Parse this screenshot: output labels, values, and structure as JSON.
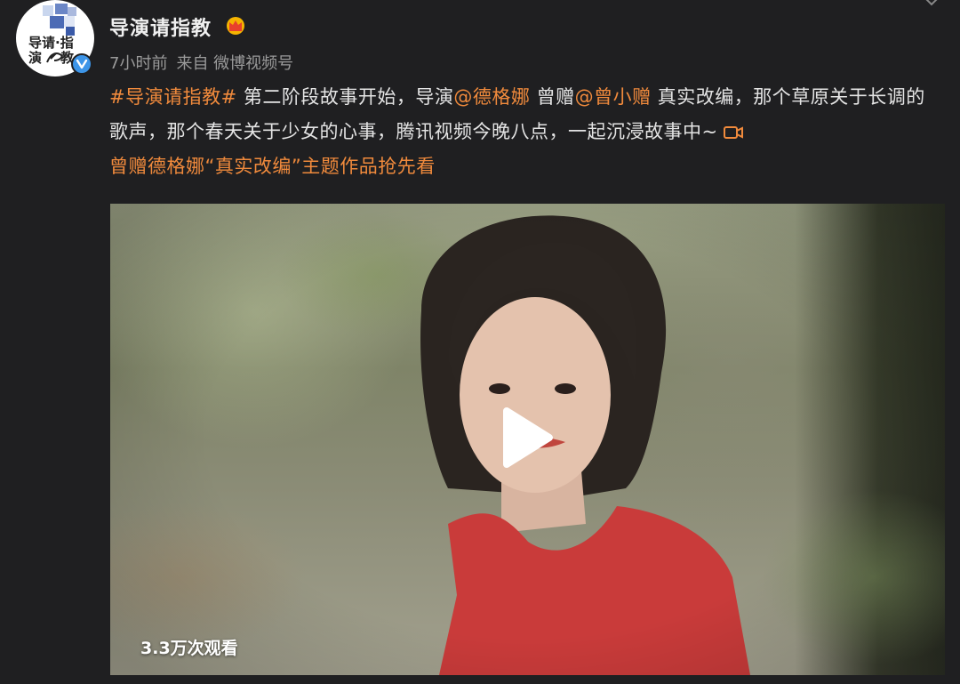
{
  "post": {
    "author": "导演请指教",
    "time": "7小时前",
    "source": "来自 微博视频号",
    "hashtag": "#导演请指教#",
    "text1": " 第二阶段故事开始，导演",
    "mention1": "@德格娜",
    "text2": " 曾赠",
    "mention2": "@曾小赠",
    "text3": " 真实改编，那个草原关于长调的歌声，那个春天关于少女的心事，腾讯视频今晚八点，一起沉浸故事中~",
    "video_link": "曾赠德格娜“真实改编”主题作品抢先看",
    "avatar_text": [
      "导请·指",
      "演",
      "教"
    ]
  },
  "video": {
    "views": "3.3万次观看"
  },
  "icons": {
    "crown": "crown-icon",
    "verified": "verified-icon",
    "play": "play-icon",
    "video_link": "video-link-icon",
    "menu": "chevron-down-icon"
  },
  "colors": {
    "background": "#1f1f21",
    "accent": "#f08a3c",
    "verified": "#3d95e8"
  }
}
